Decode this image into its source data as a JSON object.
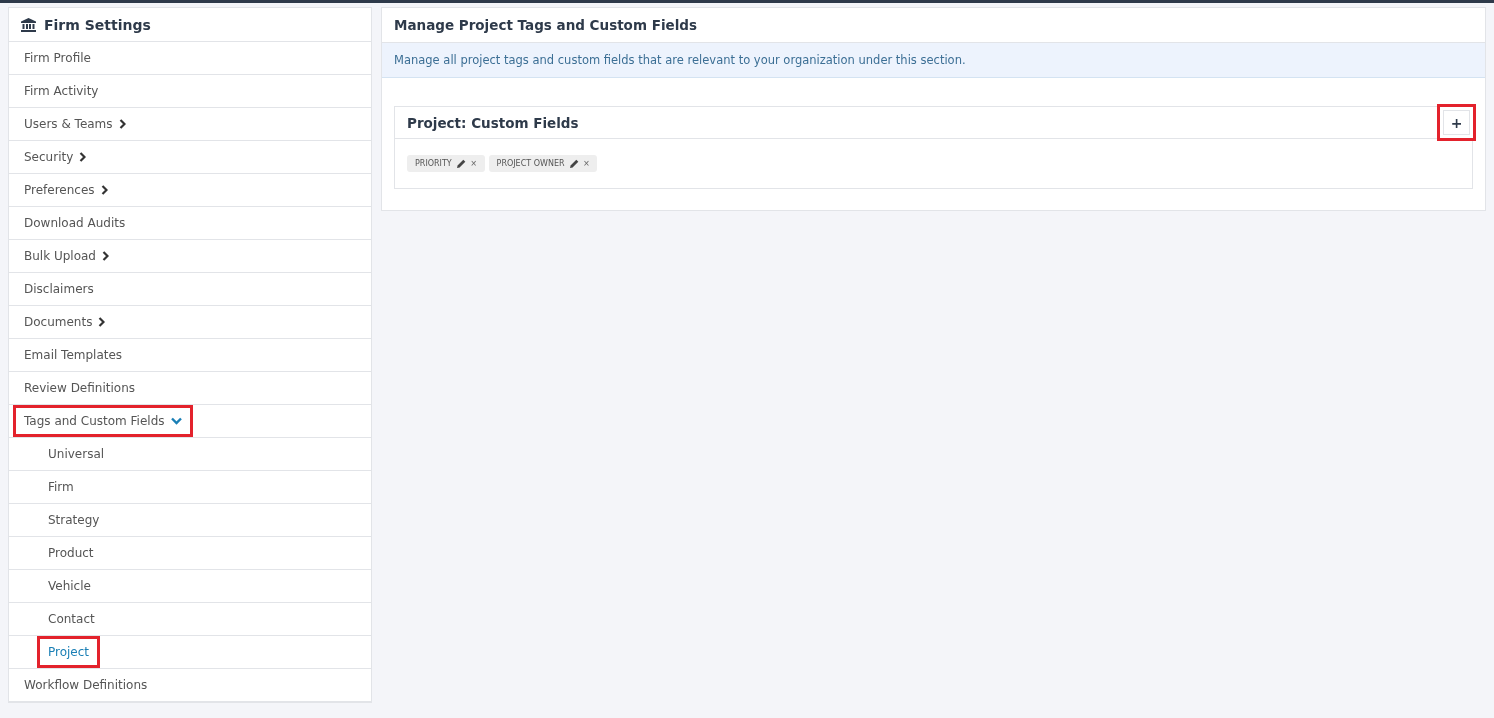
{
  "sidebar": {
    "title": "Firm Settings",
    "items": [
      {
        "label": "Firm Profile",
        "selected": false,
        "highlighted": false
      },
      {
        "label": "Firm Activity",
        "selected": false,
        "highlighted": false
      },
      {
        "label": "Users & Teams",
        "selected": false,
        "highlighted": false,
        "expanded": false
      },
      {
        "label": "Security",
        "selected": false,
        "highlighted": false,
        "expanded": false
      },
      {
        "label": "Preferences",
        "selected": false,
        "highlighted": false,
        "expanded": false
      },
      {
        "label": "Download Audits",
        "selected": false,
        "highlighted": false
      },
      {
        "label": "Bulk Upload",
        "selected": false,
        "highlighted": false,
        "expanded": false
      },
      {
        "label": "Disclaimers",
        "selected": false,
        "highlighted": false
      },
      {
        "label": "Documents",
        "selected": false,
        "highlighted": false,
        "expanded": false
      },
      {
        "label": "Email Templates",
        "selected": false,
        "highlighted": false
      },
      {
        "label": "Review Definitions",
        "selected": false,
        "highlighted": false
      },
      {
        "label": "Tags and Custom Fields",
        "selected": false,
        "highlighted": true,
        "expanded": true,
        "children": [
          {
            "label": "Universal",
            "selected": false,
            "highlighted": false
          },
          {
            "label": "Firm",
            "selected": false,
            "highlighted": false
          },
          {
            "label": "Strategy",
            "selected": false,
            "highlighted": false
          },
          {
            "label": "Product",
            "selected": false,
            "highlighted": false
          },
          {
            "label": "Vehicle",
            "selected": false,
            "highlighted": false
          },
          {
            "label": "Contact",
            "selected": false,
            "highlighted": false
          },
          {
            "label": "Project",
            "selected": true,
            "highlighted": true
          }
        ]
      },
      {
        "label": "Workflow Definitions",
        "selected": false,
        "highlighted": false
      }
    ]
  },
  "main": {
    "title": "Manage Project Tags and Custom Fields",
    "info": "Manage all project tags and custom fields that are relevant to your organization under this section.",
    "card": {
      "title": "Project: Custom Fields",
      "add_button": {
        "label": "+",
        "highlighted": true
      },
      "tags": [
        {
          "label": "PRIORITY",
          "remove": "×"
        },
        {
          "label": "PROJECT OWNER",
          "remove": "×"
        }
      ]
    }
  }
}
